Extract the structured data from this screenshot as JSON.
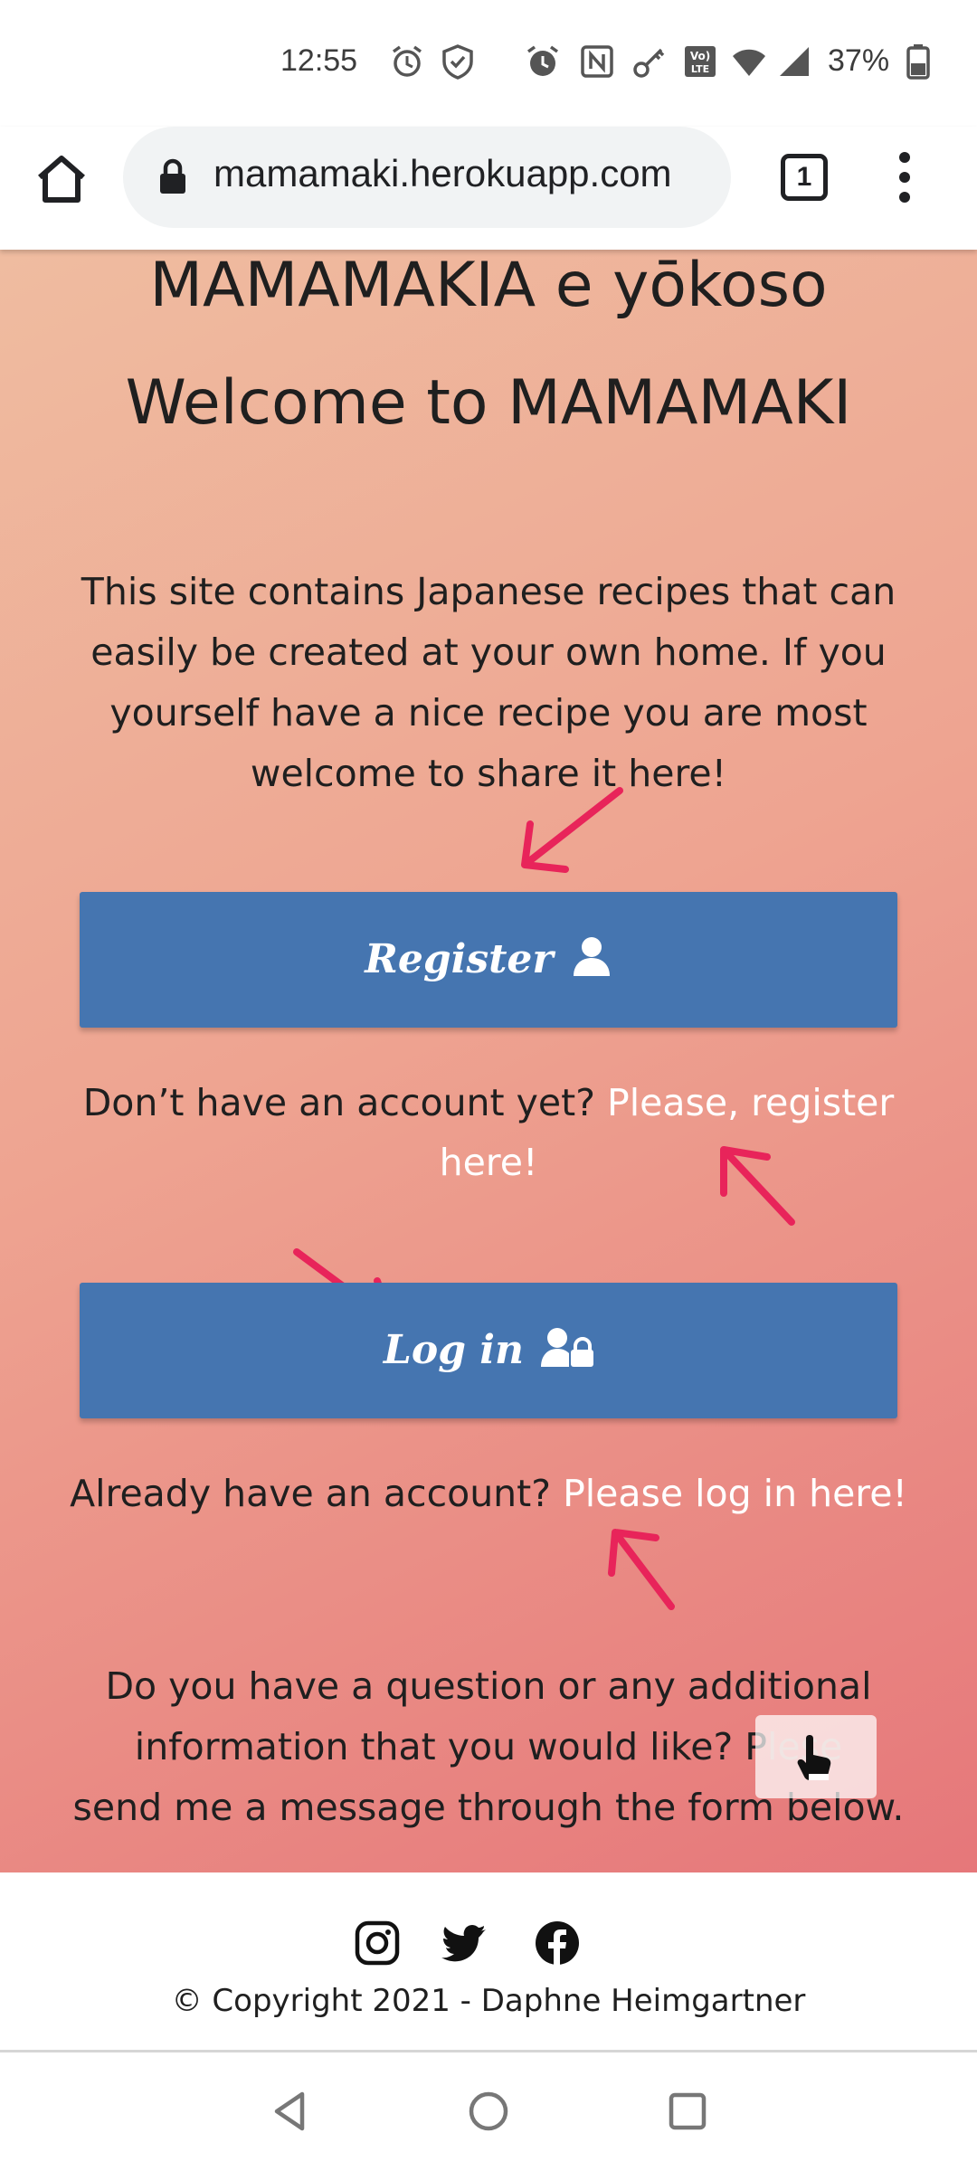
{
  "status_bar": {
    "time": "12:55",
    "battery": "37%",
    "icons": [
      "alarm-icon",
      "shield-check-icon",
      "alarm-icon",
      "nfc-icon",
      "key-icon",
      "volte-icon",
      "wifi-icon",
      "signal-icon",
      "battery-icon"
    ]
  },
  "browser": {
    "url": "mamamaki.herokuapp.com",
    "tab_count": "1"
  },
  "page": {
    "title_japanese": "MAMAMAKIA e yōkoso",
    "title_english": "Welcome to MAMAMAKI",
    "intro_lines": [
      "This site contains Japanese recipes that can",
      "easily be created at your own home. If you",
      "yourself have a nice recipe you are most",
      "welcome to share it here!"
    ],
    "register_button": "Register",
    "register_prompt": "Don’t have an account yet?",
    "register_link_a": "Please, register",
    "register_link_b": "here!",
    "login_button": "Log in",
    "login_prompt": "Already have an account?",
    "login_link": "Please log in here!",
    "contact_line1": "Do you have a question or any additional",
    "contact_line2_a": "information that you would like? P",
    "contact_line2_b": "le",
    "contact_line2_c": "se",
    "contact_line3": "send me a message through the form below.",
    "arrow_color": "#e8245a",
    "button_color": "#4575b0"
  },
  "footer": {
    "copyright": "© Copyright 2021 - Daphne Heimgartner",
    "social": [
      "instagram-icon",
      "twitter-icon",
      "facebook-icon"
    ]
  }
}
